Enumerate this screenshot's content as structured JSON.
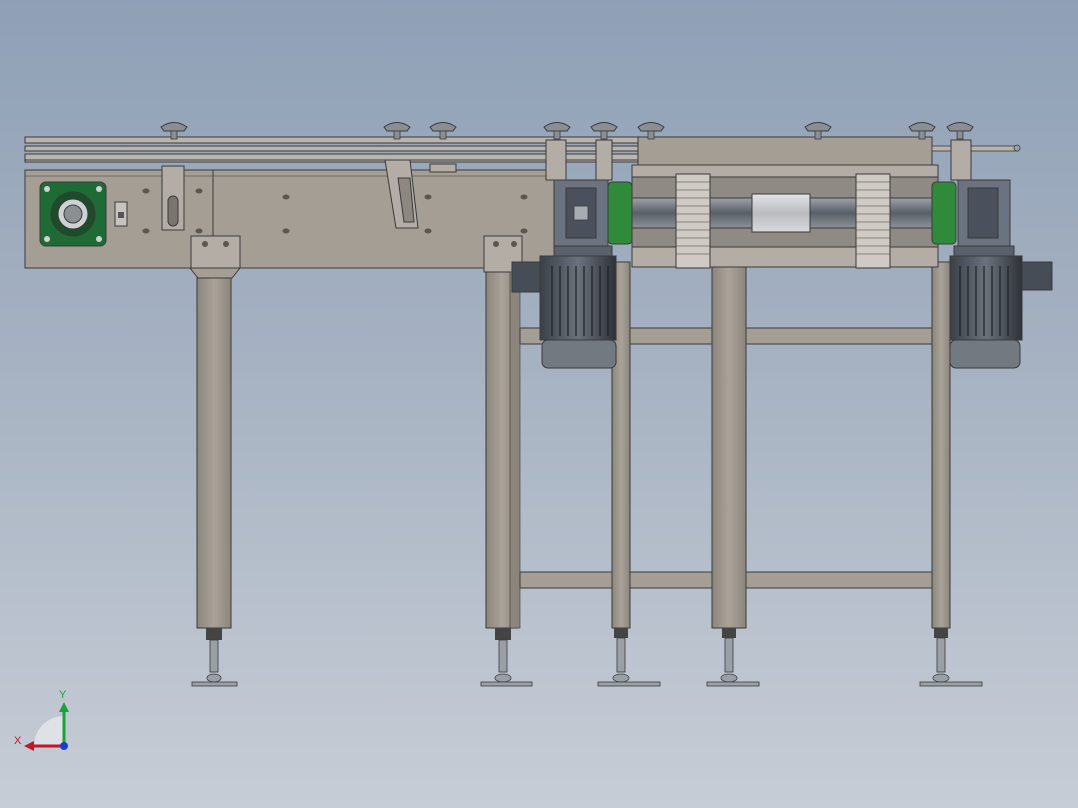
{
  "colors": {
    "frame": "#a59e94",
    "frame_dark": "#857e75",
    "edge": "#3a3a3a",
    "rail": "#b9b4ad",
    "motor": "#5a616b",
    "motor_dark": "#2b2f35",
    "gear_green": "#2f8a3a",
    "bearing_green": "#1f6b35",
    "knob": "#8a8f96",
    "foot": "#9aa0a8",
    "bg_top": "#8fa0b6",
    "bg_bottom": "#c7cdd6"
  },
  "triad": {
    "x_label": "X",
    "y_label": "Y",
    "x_color": "#c0182a",
    "y_color": "#1aa33b",
    "z_color": "#1c3fc7"
  }
}
